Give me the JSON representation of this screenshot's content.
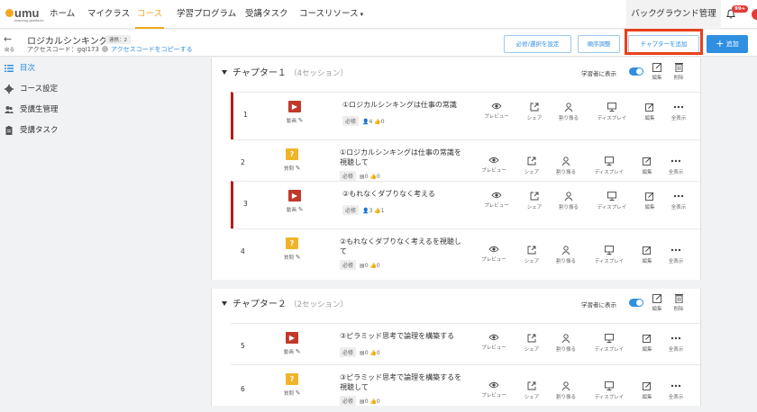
{
  "nav": {
    "logo": "umu",
    "logo_sub": "learning platform",
    "items": [
      {
        "label": "ホーム"
      },
      {
        "label": "マイクラス"
      },
      {
        "label": "コース"
      },
      {
        "label": "学習プログラム"
      },
      {
        "label": "受講タスク"
      },
      {
        "label": "コースリソース"
      }
    ],
    "admin": "バックグラウンド管理",
    "notification_count": "99+"
  },
  "header": {
    "back_label": "戻る",
    "course_title": "ロジカルシンキング",
    "course_tag": "連携：2",
    "access_code_label": "アクセスコード：gqI173",
    "copy_link": "アクセスコードをコピーする",
    "buttons": {
      "required": "必修/選択を設定",
      "order": "順序調整",
      "add_chapter": "チャプターを追加",
      "add": "追加"
    }
  },
  "sidebar": {
    "items": [
      {
        "label": "目次"
      },
      {
        "label": "コース設定"
      },
      {
        "label": "受講生管理"
      },
      {
        "label": "受講タスク"
      }
    ]
  },
  "labels": {
    "show_to_learners": "学習者に表示",
    "edit": "編集",
    "delete": "削除",
    "preview": "プレビュー",
    "share": "シェア",
    "assign": "割り振る",
    "display": "ディスプレイ",
    "show_all": "全表示",
    "required": "必修",
    "video": "動画",
    "question": "質問"
  },
  "chapters": [
    {
      "title": "チャプター１",
      "count": "（4セッション）",
      "sessions": [
        {
          "num": "1",
          "type": "video",
          "title": "①ロジカルシンキングは仕事の常識",
          "count1": "4",
          "count2": "0"
        },
        {
          "num": "2",
          "type": "question",
          "title": "①ロジカルシンキングは仕事の常識を視聴して",
          "count1": "0",
          "count2": "0"
        },
        {
          "num": "3",
          "type": "video",
          "title": "②もれなくダブりなく考える",
          "count1": "3",
          "count2": "1"
        },
        {
          "num": "4",
          "type": "question",
          "title": "②もれなくダブりなく考えるを視聴して",
          "count1": "0",
          "count2": "0"
        }
      ]
    },
    {
      "title": "チャプター２",
      "count": "（2セッション）",
      "sessions": [
        {
          "num": "5",
          "type": "video",
          "title": "③ピラミッド思考で論理を構築する",
          "count1": "0",
          "count2": "0"
        },
        {
          "num": "6",
          "type": "question",
          "title": "③ピラミッド思考で論理を構築するを視聴して",
          "count1": "0",
          "count2": "0"
        }
      ]
    }
  ],
  "colors": {
    "accent": "#2f8fe0",
    "nav_active": "#f5a623",
    "highlight": "#e8401c",
    "video": "#c0392b",
    "question": "#f0b429"
  }
}
